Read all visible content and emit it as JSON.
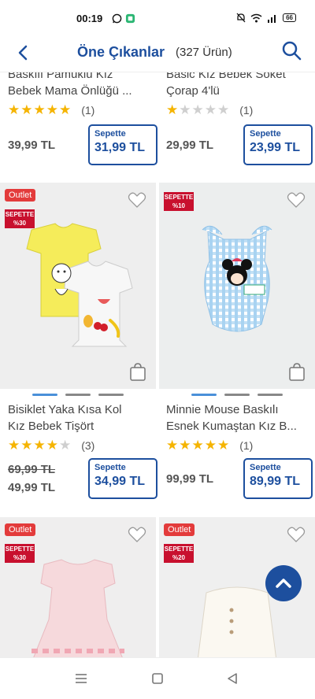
{
  "status": {
    "time": "00:19",
    "battery": "66"
  },
  "header": {
    "title": "Öne Çıkanlar",
    "count": "(327 Ürün)"
  },
  "top_row": [
    {
      "name_line1": "Baskılı Pamuklu Kız",
      "name_line2": "Bebek Mama Önlüğü ...",
      "stars": 5,
      "rating_count": "(1)",
      "old_price": "39,99 TL",
      "sepette_label": "Sepette",
      "sepette_price": "31,99 TL"
    },
    {
      "name_line1": "Basic Kız Bebek Soket",
      "name_line2": "Çorap 4'lü",
      "stars": 1,
      "rating_count": "(1)",
      "old_price": "29,99 TL",
      "sepette_label": "Sepette",
      "sepette_price": "23,99 TL"
    }
  ],
  "mid_row": [
    {
      "outlet": "Outlet",
      "badge_line1": "SEPETTE",
      "badge_line2": "%30",
      "name_line1": "Bisiklet Yaka Kısa Kol",
      "name_line2": "Kız Bebek Tişört",
      "stars": 4,
      "rating_count": "(3)",
      "list_price": "69,99 TL",
      "price": "49,99 TL",
      "sepette_label": "Sepette",
      "sepette_price": "34,99 TL"
    },
    {
      "badge_line1": "SEPETTE",
      "badge_line2": "%10",
      "name_line1": "Minnie Mouse Baskılı",
      "name_line2": "Esnek Kumaştan Kız B...",
      "stars": 5,
      "rating_count": "(1)",
      "price": "99,99 TL",
      "sepette_label": "Sepette",
      "sepette_price": "89,99 TL"
    }
  ],
  "bottom_row": [
    {
      "outlet": "Outlet",
      "badge_line1": "SEPETTE",
      "badge_line2": "%30"
    },
    {
      "outlet": "Outlet",
      "badge_line1": "SEPETTE",
      "badge_line2": "%20"
    }
  ],
  "colors": {
    "brand": "#1d4f9e",
    "outlet": "#e33b3b",
    "badge": "#c8102e",
    "star": "#f5b400"
  }
}
